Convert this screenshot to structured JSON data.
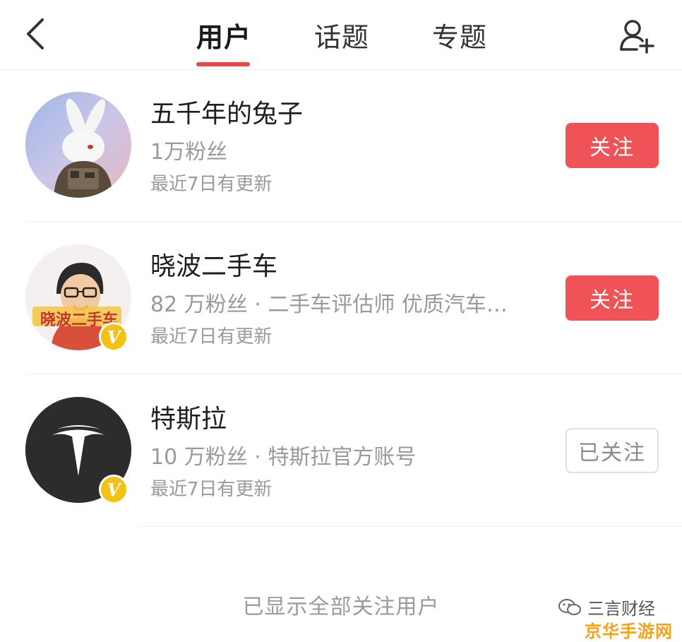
{
  "nav": {
    "tabs": [
      {
        "label": "用户",
        "active": true
      },
      {
        "label": "话题",
        "active": false
      },
      {
        "label": "专题",
        "active": false
      }
    ],
    "back_icon": "chevron-left-icon",
    "add_user_icon": "add-user-icon",
    "accent_color": "#e8474b"
  },
  "users": [
    {
      "name": "五千年的兔子",
      "meta": "1万粉丝",
      "update": "最近7日有更新",
      "verified": false,
      "follow_label": "关注",
      "followed": false
    },
    {
      "name": "晓波二手车",
      "meta": "82 万粉丝 · 二手车评估师 优质汽车…",
      "update": "最近7日有更新",
      "verified": true,
      "avatar_text": "晓波二手车",
      "follow_label": "关注",
      "followed": false
    },
    {
      "name": "特斯拉",
      "meta": "10 万粉丝 · 特斯拉官方账号",
      "update": "最近7日有更新",
      "verified": true,
      "follow_label": "已关注",
      "followed": true
    }
  ],
  "footer": "已显示全部关注用户",
  "verified_badge_letter": "V",
  "watermark": {
    "text": "三言财经",
    "sub": "京华手游网"
  }
}
